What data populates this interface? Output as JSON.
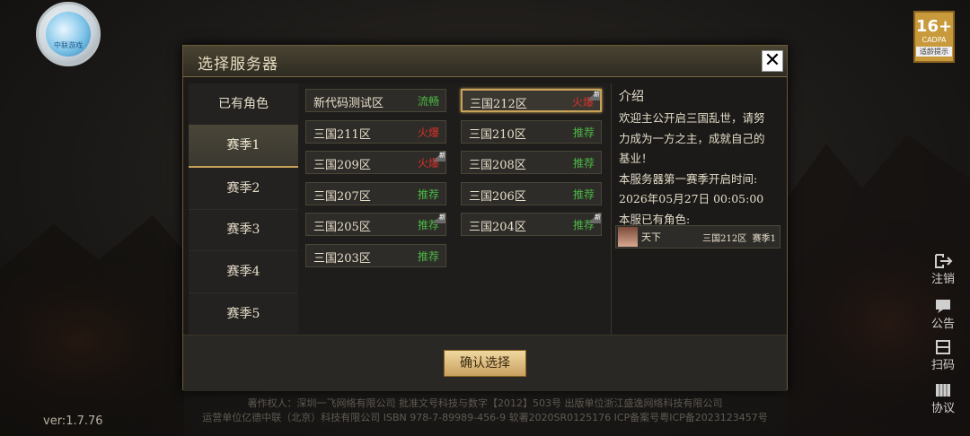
{
  "logo": {
    "text": "中联游戏"
  },
  "age_rating": {
    "value": "16+",
    "org": "CADPA",
    "tip": "适龄提示"
  },
  "side_menu": [
    {
      "label": "注销",
      "icon": "logout-icon"
    },
    {
      "label": "公告",
      "icon": "notice-icon"
    },
    {
      "label": "扫码",
      "icon": "scan-icon"
    },
    {
      "label": "协议",
      "icon": "agreement-icon"
    }
  ],
  "version": "ver:1.7.76",
  "copyright": [
    "著作权人：深圳一飞网络有限公司 批准文号科技与数字【2012】503号 出版单位浙江盛逸网络科技有限公司",
    "运营单位亿德中联（北京）科技有限公司 ISBN 978-7-89989-456-9 软著2020SR0125176 ICP备案号粤ICP备2023123457号"
  ],
  "dialog": {
    "title": "选择服务器",
    "close_label": "✕",
    "tabs": [
      "已有角色",
      "赛季1",
      "赛季2",
      "赛季3",
      "赛季4",
      "赛季5"
    ],
    "active_tab": 1,
    "servers_col1": [
      {
        "name": "新代码测试区",
        "status": "流畅",
        "kind": "rec",
        "new": false
      },
      {
        "name": "三国211区",
        "status": "火爆",
        "kind": "hot",
        "new": false
      },
      {
        "name": "三国209区",
        "status": "火爆",
        "kind": "hot",
        "new": true
      },
      {
        "name": "三国207区",
        "status": "推荐",
        "kind": "rec",
        "new": false
      },
      {
        "name": "三国205区",
        "status": "推荐",
        "kind": "rec",
        "new": true
      },
      {
        "name": "三国203区",
        "status": "推荐",
        "kind": "rec",
        "new": false
      }
    ],
    "servers_col2": [
      {
        "name": "三国212区",
        "status": "火爆",
        "kind": "hot",
        "new": true,
        "selected": true
      },
      {
        "name": "三国210区",
        "status": "推荐",
        "kind": "rec",
        "new": false
      },
      {
        "name": "三国208区",
        "status": "推荐",
        "kind": "rec",
        "new": false
      },
      {
        "name": "三国206区",
        "status": "推荐",
        "kind": "rec",
        "new": false
      },
      {
        "name": "三国204区",
        "status": "推荐",
        "kind": "rec",
        "new": true
      }
    ],
    "new_tag": "新",
    "info": {
      "title": "介绍",
      "lines": [
        "欢迎主公开启三国乱世，请努",
        "力成为一方之主，成就自己的",
        "基业！",
        "本服务器第一赛季开启时间:",
        "2026年05月27日 00:05:00",
        "本服已有角色:"
      ],
      "character": {
        "name": "天下",
        "server": "三国212区",
        "season": "赛季1"
      }
    },
    "confirm_label": "确认选择"
  },
  "colors": {
    "hot": "#d8322a",
    "recommend": "#4bb844",
    "gold": "#c9a25a"
  }
}
